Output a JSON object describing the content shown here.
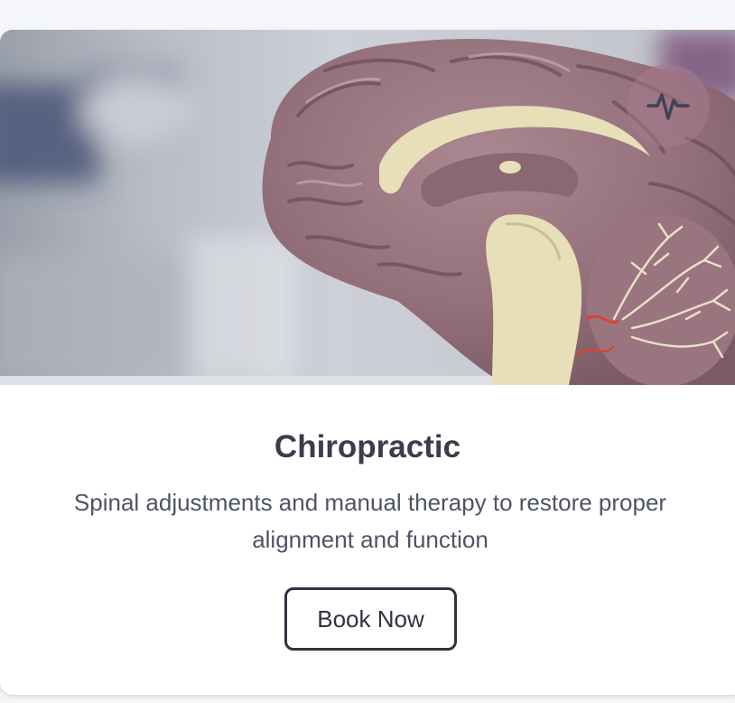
{
  "service_card": {
    "image": {
      "subject": "anatomical brain model cross-section",
      "icon": "pulse-icon"
    },
    "title": "Chiropractic",
    "description": "Spinal adjustments and manual therapy to restore proper alignment and function",
    "cta_label": "Book Now"
  },
  "colors": {
    "page_background": "#f5f6f9",
    "card_background": "#ffffff",
    "title_text": "#3a3d4a",
    "body_text": "#4f5464",
    "button_border": "#2f3340",
    "brain_tissue": "#9a7580",
    "brain_highlight": "#e7dfb8"
  }
}
